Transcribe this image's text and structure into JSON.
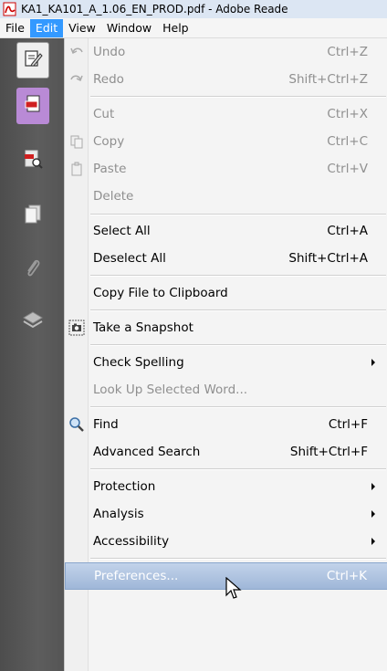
{
  "window": {
    "title": "KA1_KA101_A_1.06_EN_PROD.pdf - Adobe Reade"
  },
  "menubar": {
    "items": [
      "File",
      "Edit",
      "View",
      "Window",
      "Help"
    ]
  },
  "edit_menu": {
    "items": [
      {
        "label": "Undo",
        "shortcut": "Ctrl+Z"
      },
      {
        "label": "Redo",
        "shortcut": "Shift+Ctrl+Z"
      },
      {
        "label": "Cut",
        "shortcut": "Ctrl+X"
      },
      {
        "label": "Copy",
        "shortcut": "Ctrl+C"
      },
      {
        "label": "Paste",
        "shortcut": "Ctrl+V"
      },
      {
        "label": "Delete",
        "shortcut": ""
      },
      {
        "label": "Select All",
        "shortcut": "Ctrl+A"
      },
      {
        "label": "Deselect All",
        "shortcut": "Shift+Ctrl+A"
      },
      {
        "label": "Copy File to Clipboard",
        "shortcut": ""
      },
      {
        "label": "Take a Snapshot",
        "shortcut": ""
      },
      {
        "label": "Check Spelling",
        "shortcut": ""
      },
      {
        "label": "Look Up Selected Word...",
        "shortcut": ""
      },
      {
        "label": "Find",
        "shortcut": "Ctrl+F"
      },
      {
        "label": "Advanced Search",
        "shortcut": "Shift+Ctrl+F"
      },
      {
        "label": "Protection",
        "shortcut": ""
      },
      {
        "label": "Analysis",
        "shortcut": ""
      },
      {
        "label": "Accessibility",
        "shortcut": ""
      },
      {
        "label": "Preferences...",
        "shortcut": "Ctrl+K"
      }
    ]
  },
  "colors": {
    "menu_highlight": "#3399ff",
    "item_highlight": "#a9bfde",
    "sidebar": "#555555",
    "sidebar_selected": "#b98ad6"
  }
}
